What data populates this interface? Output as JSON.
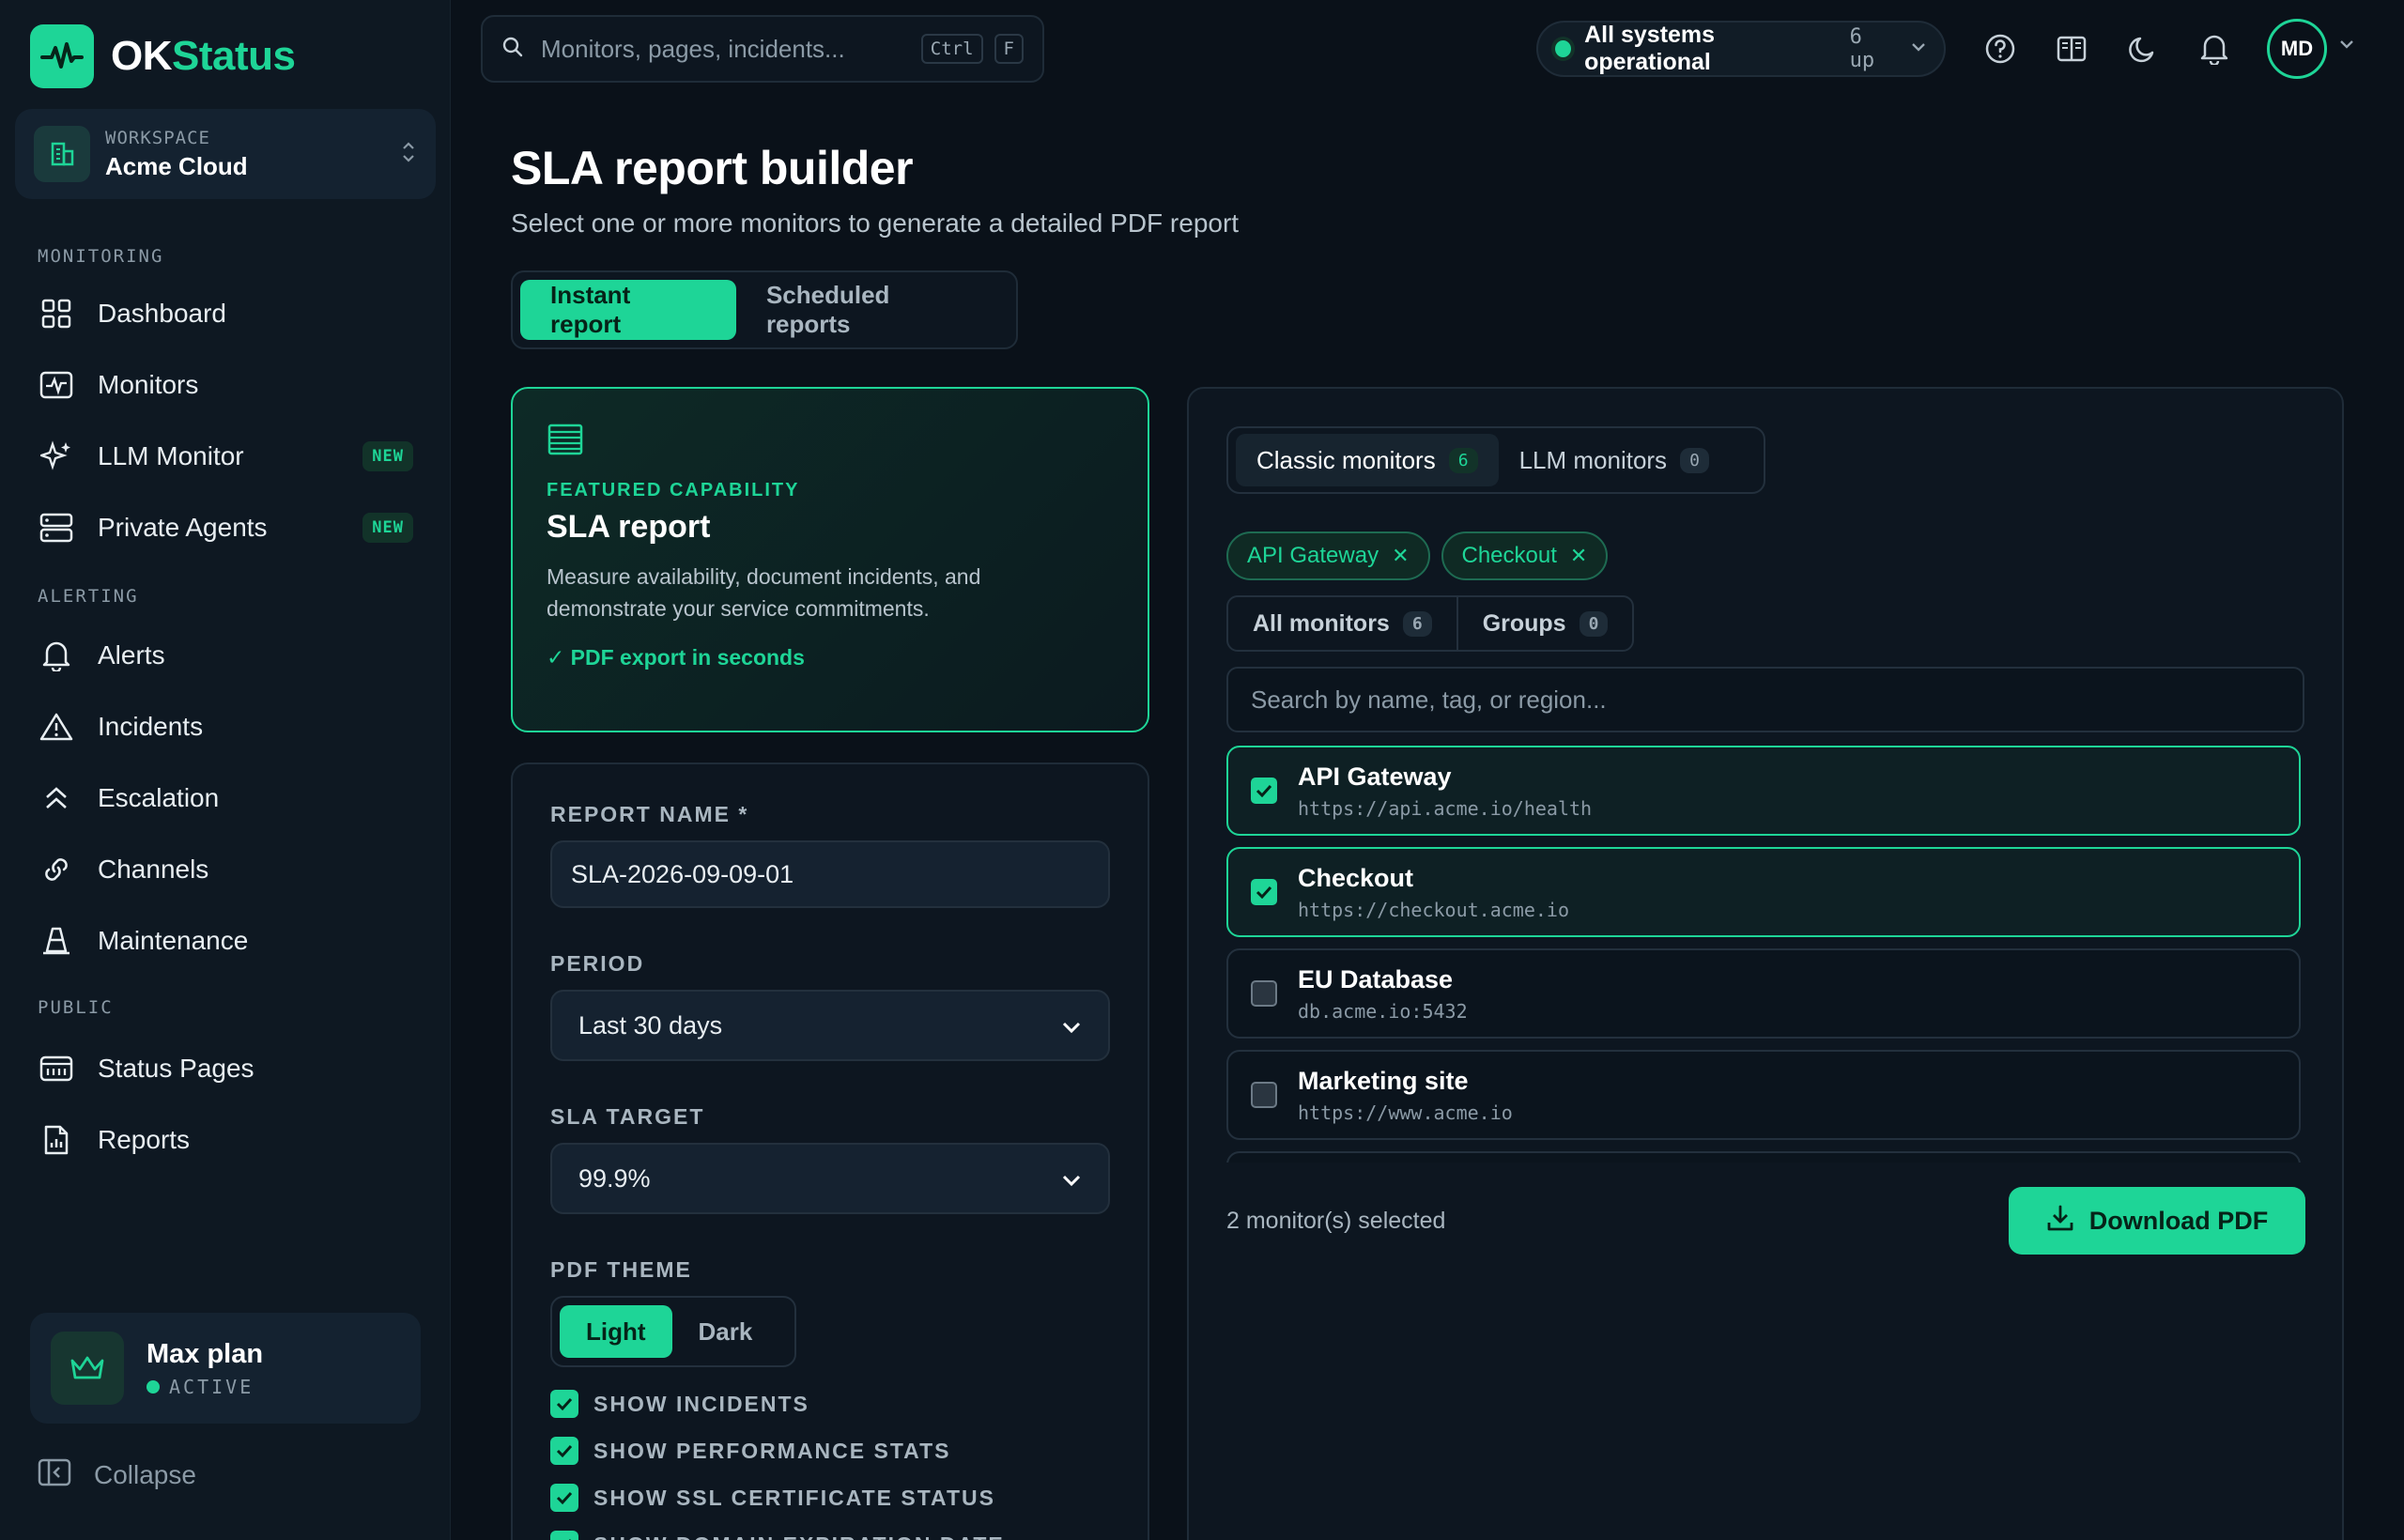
{
  "brand": {
    "ok": "OK",
    "status": "Status"
  },
  "workspace": {
    "caption": "WORKSPACE",
    "name": "Acme Cloud"
  },
  "sidebar": {
    "sections": [
      "MONITORING",
      "ALERTING",
      "PUBLIC"
    ],
    "items": [
      {
        "label": "Dashboard",
        "icon": "dashboard-grid-icon"
      },
      {
        "label": "Monitors",
        "icon": "pulse-monitor-icon"
      },
      {
        "label": "LLM Monitor",
        "icon": "sparkle-icon",
        "badge": "NEW"
      },
      {
        "label": "Private Agents",
        "icon": "server-icon",
        "badge": "NEW"
      },
      {
        "label": "Alerts",
        "icon": "bell-icon"
      },
      {
        "label": "Incidents",
        "icon": "warning-triangle-icon"
      },
      {
        "label": "Escalation",
        "icon": "chevrons-up-icon"
      },
      {
        "label": "Channels",
        "icon": "link-icon"
      },
      {
        "label": "Maintenance",
        "icon": "cone-icon"
      },
      {
        "label": "Status Pages",
        "icon": "status-page-icon"
      },
      {
        "label": "Reports",
        "icon": "report-icon"
      }
    ],
    "plan": {
      "name": "Max plan",
      "status": "ACTIVE"
    },
    "collapse": "Collapse"
  },
  "topbar": {
    "search_placeholder": "Monitors, pages, incidents...",
    "kbd1": "Ctrl",
    "kbd2": "F",
    "status_text": "All systems operational",
    "status_up": "6 up",
    "avatar": "MD"
  },
  "main": {
    "title": "SLA report builder",
    "subtitle": "Select one or more monitors to generate a detailed PDF report",
    "tabs": [
      "Instant report",
      "Scheduled reports"
    ],
    "feature": {
      "caption": "FEATURED CAPABILITY",
      "title": "SLA report",
      "desc": "Measure availability, document incidents, and demonstrate your service commitments.",
      "check": "✓ PDF export in seconds"
    },
    "form": {
      "report_name_label": "REPORT NAME *",
      "report_name_value": "SLA-2026-09-09-01",
      "period_label": "PERIOD",
      "period_value": "Last 30 days",
      "sla_label": "SLA TARGET",
      "sla_value": "99.9%",
      "theme_label": "PDF THEME",
      "theme_options": [
        "Light",
        "Dark"
      ],
      "checks": [
        "SHOW INCIDENTS",
        "SHOW PERFORMANCE STATS",
        "SHOW SSL CERTIFICATE STATUS",
        "SHOW DOMAIN EXPIRATION DATE"
      ]
    }
  },
  "panel": {
    "type_tabs": [
      {
        "label": "Classic monitors",
        "count": "6"
      },
      {
        "label": "LLM monitors",
        "count": "0"
      }
    ],
    "chips": [
      "API Gateway",
      "Checkout"
    ],
    "filter_tabs": [
      {
        "label": "All monitors",
        "count": "6"
      },
      {
        "label": "Groups",
        "count": "0"
      }
    ],
    "search_placeholder": "Search by name, tag, or region...",
    "monitors": [
      {
        "name": "API Gateway",
        "url": "https://api.acme.io/health",
        "selected": true
      },
      {
        "name": "Checkout",
        "url": "https://checkout.acme.io",
        "selected": true
      },
      {
        "name": "EU Database",
        "url": "db.acme.io:5432",
        "selected": false
      },
      {
        "name": "Marketing site",
        "url": "https://www.acme.io",
        "selected": false
      }
    ],
    "selected_count": "2 monitor(s) selected",
    "download_label": "Download PDF"
  },
  "colors": {
    "accent": "#1ed597",
    "background": "#0a1119",
    "sidebar": "#0e1822"
  }
}
